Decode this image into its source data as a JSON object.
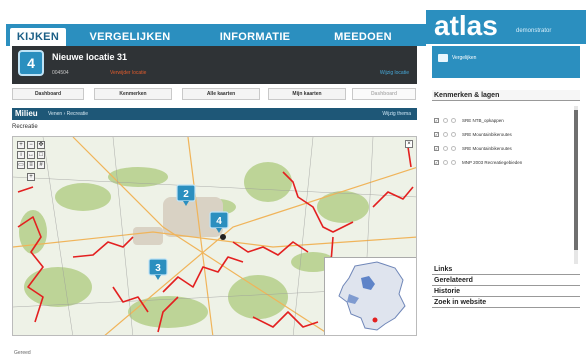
{
  "nav": {
    "tabs": [
      "KIJKEN",
      "VERGELIJKEN",
      "INFORMATIE",
      "MEEDOEN"
    ],
    "active": "KIJKEN",
    "brand": "atlas",
    "brand_sub": "demonstrator"
  },
  "location": {
    "number": "4",
    "title": "Nieuwe locatie 31",
    "code": "004504",
    "remove": "Verwijder locatie",
    "link": "Wijzig locatie"
  },
  "subtabs": [
    "Dashboard",
    "Kenmerken",
    "Alle kaarten",
    "Mijn kaarten",
    "Dashboard"
  ],
  "subtab_disabled_index": 4,
  "section": {
    "title": "Milieu",
    "breadcrumb_1": "Venen",
    "breadcrumb_2": "Recreatie",
    "right_link": "Wijzig thema",
    "remarks": "Recreatie"
  },
  "map": {
    "markers": [
      "2",
      "4",
      "3"
    ],
    "tool_icons": [
      "zoom-in-icon",
      "zoom-out-icon",
      "pan-icon",
      "info-icon",
      "measure-icon",
      "select-icon",
      "print-icon",
      "layers-icon",
      "grid-icon"
    ]
  },
  "sidebar": {
    "top_label": "Vergelijken",
    "panel_title": "Kenmerken & lagen",
    "layers": [
      "SRE NTB_opkappen",
      "SRE Mountainbikeroutes",
      "SRE Mountainbikeroutes",
      "MNP 2003 Recreatiegebieden"
    ],
    "links": [
      "Links",
      "Gerelateerd",
      "Historie",
      "Zoek in website"
    ]
  },
  "footer": "Gereed",
  "colors": {
    "accent": "#2b8fbf",
    "dark_header": "#2f3336",
    "route_red": "#e32020"
  }
}
